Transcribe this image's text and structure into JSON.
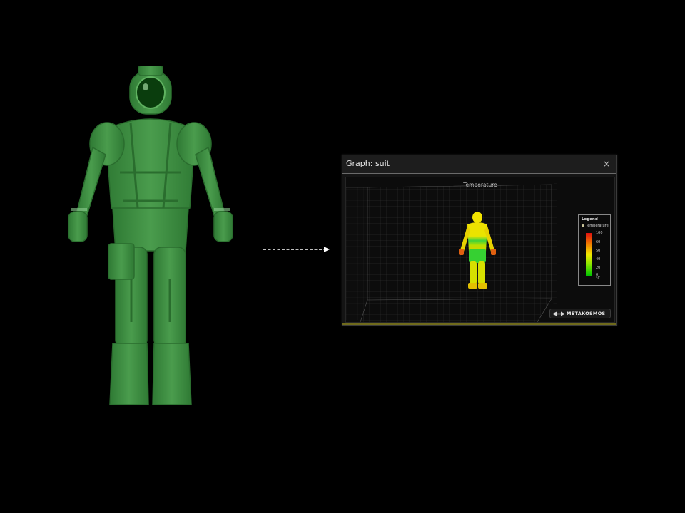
{
  "window": {
    "title": "Graph: suit",
    "close_icon": "×"
  },
  "chart": {
    "title": "Temperature",
    "legend": {
      "title": "Legend",
      "item": "Temperature",
      "ticks": [
        "100",
        "60",
        "50",
        "40",
        "20",
        "0"
      ],
      "unit": "°C"
    }
  },
  "branding": {
    "logo_text": "METAKOSMOS"
  },
  "colors": {
    "suit_green": "#3e8e41",
    "accent_olive": "#6f6a1c",
    "heat_hot": "#e01010",
    "heat_mid": "#f2e700",
    "heat_cold": "#00c400"
  },
  "icons": {
    "close": "close-icon",
    "arrow": "dashed-arrow-right-icon",
    "logo": "metakosmos-logo-icon"
  }
}
